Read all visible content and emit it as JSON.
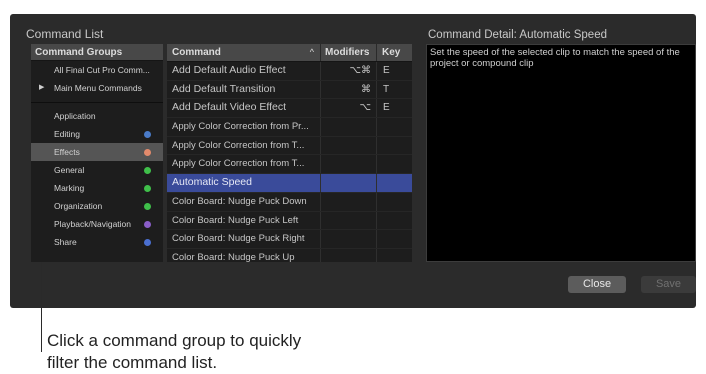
{
  "window": {
    "title": "Command List",
    "detail_title": "Command Detail: Automatic Speed",
    "detail_text": "Set the speed of the selected clip to match the speed of the project or compound clip",
    "close_label": "Close",
    "save_label": "Save"
  },
  "groups": {
    "header": "Command Groups",
    "top_items": [
      {
        "label": "All Final Cut Pro Comm...",
        "arrow": ""
      },
      {
        "label": "Main Menu Commands",
        "arrow": "▶"
      }
    ],
    "items": [
      {
        "label": "Application",
        "color": ""
      },
      {
        "label": "Editing",
        "color": "#4a7bc8"
      },
      {
        "label": "Effects",
        "color": "#e28a6c"
      },
      {
        "label": "General",
        "color": "#3fbf4a"
      },
      {
        "label": "Marking",
        "color": "#3fbf4a"
      },
      {
        "label": "Organization",
        "color": "#3fbf4a"
      },
      {
        "label": "Playback/Navigation",
        "color": "#8a5ec8"
      },
      {
        "label": "Share",
        "color": "#4a6fd0"
      }
    ],
    "selected_index": 2
  },
  "commands": {
    "headers": {
      "command": "Command",
      "caret": "^",
      "modifiers": "Modifiers",
      "key": "Key"
    },
    "rows": [
      {
        "command": "Add Default Audio Effect",
        "modifiers": "⌥⌘",
        "key": "E"
      },
      {
        "command": "Add Default Transition",
        "modifiers": "⌘",
        "key": "T"
      },
      {
        "command": "Add Default Video Effect",
        "modifiers": "⌥",
        "key": "E"
      },
      {
        "command": "Apply Color Correction from Pr...",
        "modifiers": "",
        "key": ""
      },
      {
        "command": "Apply Color Correction from T...",
        "modifiers": "",
        "key": ""
      },
      {
        "command": "Apply Color Correction from T...",
        "modifiers": "",
        "key": ""
      },
      {
        "command": "Automatic Speed",
        "modifiers": "",
        "key": ""
      },
      {
        "command": "Color Board: Nudge Puck Down",
        "modifiers": "",
        "key": ""
      },
      {
        "command": "Color Board: Nudge Puck Left",
        "modifiers": "",
        "key": ""
      },
      {
        "command": "Color Board: Nudge Puck Right",
        "modifiers": "",
        "key": ""
      },
      {
        "command": "Color Board: Nudge Puck Up",
        "modifiers": "",
        "key": ""
      }
    ],
    "selected_index": 6
  },
  "callout": {
    "line1": "Click a command group to quickly",
    "line2": "filter the command list."
  }
}
